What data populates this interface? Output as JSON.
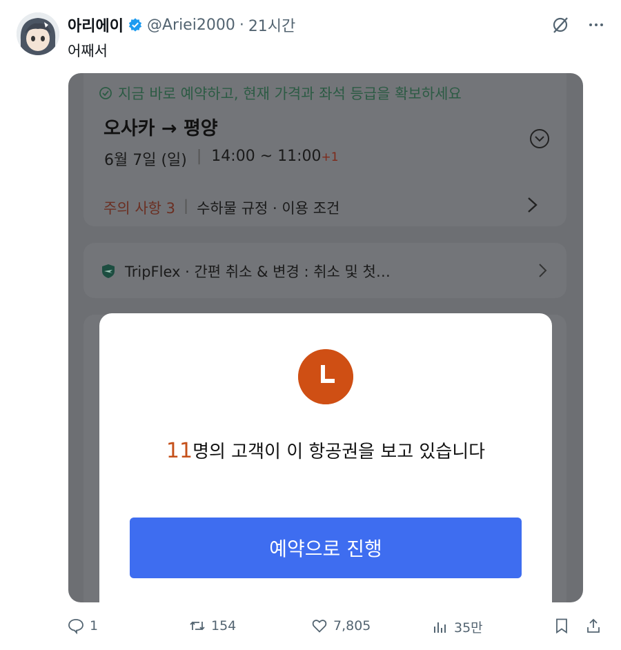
{
  "user": {
    "name": "아리에이",
    "handle": "@Ariei2000",
    "separator": "·",
    "time": "21시간"
  },
  "tweet": {
    "text": "어째서"
  },
  "booking": {
    "notice": "지금 바로 예약하고, 현재 가격과 좌석 등급을 확보하세요",
    "route": "오사카 → 평양",
    "date": "6월 7일 (일)",
    "time_range": "14:00 ~ 11:00",
    "day_offset": "+1",
    "warning": "주의 사항 3",
    "rules": "수하물 규정 · 이용 조건",
    "tripflex": "TripFlex · 간편 취소 & 변경 : 취소 및 첫…"
  },
  "modal": {
    "viewer_count": "11",
    "viewer_text": "명의 고객이 이 항공권을 보고 있습니다",
    "cta": "예약으로 진행"
  },
  "actions": {
    "replies": "1",
    "retweets": "154",
    "likes": "7,805",
    "views": "35만"
  },
  "colors": {
    "accent": "#3e6df0",
    "clock": "#cf4f14",
    "verified": "#1d9bf0"
  }
}
